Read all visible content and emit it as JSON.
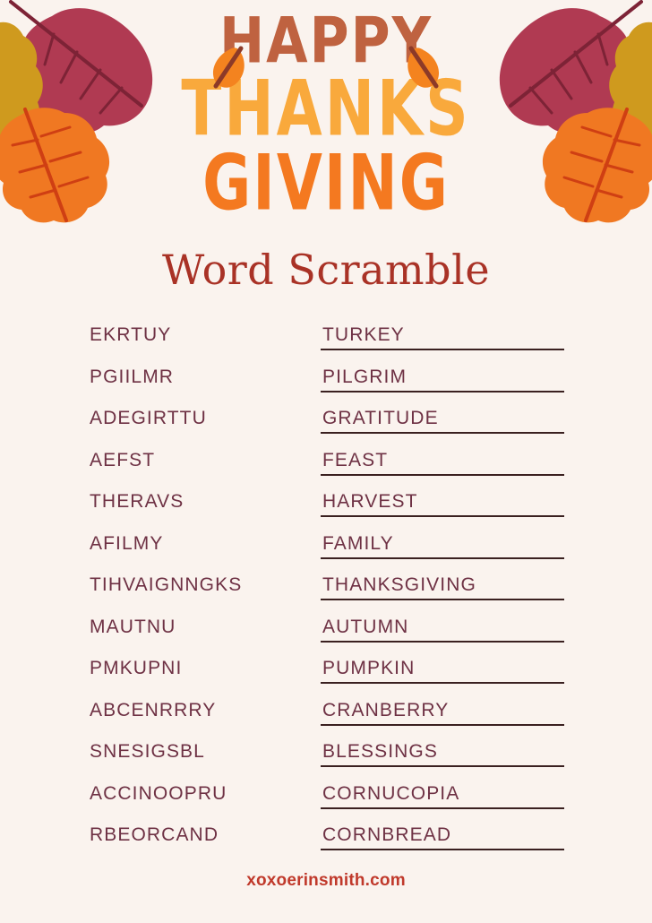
{
  "page": {
    "background_color": "#faf3ee",
    "title_line1": "HAPPY",
    "title_line2": "THANKS",
    "title_line3": "GIVING",
    "title_color1": "#bf6240",
    "title_color2": "#f9a93c",
    "title_color3": "#f47920",
    "subtitle": "Word Scramble",
    "subtitle_color": "#a93226",
    "footer": "xoxoerinsmith.com",
    "footer_color": "#c0392b",
    "text_color": "#6e3144",
    "line_color": "#3a2020"
  },
  "decorations": {
    "leaf_colors": {
      "crimson": "#b03a52",
      "crimson_vein": "#7d2336",
      "golden": "#cf9a1e",
      "golden_vein": "#9a6c18",
      "orange": "#f07822",
      "orange_vein": "#cf3f13",
      "accent_orange": "#f4831f",
      "accent_stem": "#8c3a28"
    }
  },
  "puzzle": {
    "rows": [
      {
        "scramble": "EKRTUY",
        "answer": "TURKEY"
      },
      {
        "scramble": "PGIILMR",
        "answer": "PILGRIM"
      },
      {
        "scramble": "ADEGIRTTU",
        "answer": "GRATITUDE"
      },
      {
        "scramble": "AEFST",
        "answer": "FEAST"
      },
      {
        "scramble": "THERAVS",
        "answer": "HARVEST"
      },
      {
        "scramble": "AFILMY",
        "answer": "FAMILY"
      },
      {
        "scramble": "TIHVAIGNNGKS",
        "answer": "THANKSGIVING"
      },
      {
        "scramble": "MAUTNU",
        "answer": "AUTUMN"
      },
      {
        "scramble": "PMKUPNI",
        "answer": "PUMPKIN"
      },
      {
        "scramble": "ABCENRRRY",
        "answer": "CRANBERRY"
      },
      {
        "scramble": "SNESIGSBL",
        "answer": "BLESSINGS"
      },
      {
        "scramble": "ACCINOOPRU",
        "answer": "CORNUCOPIA"
      },
      {
        "scramble": "RBEORCAND",
        "answer": "CORNBREAD"
      }
    ]
  }
}
